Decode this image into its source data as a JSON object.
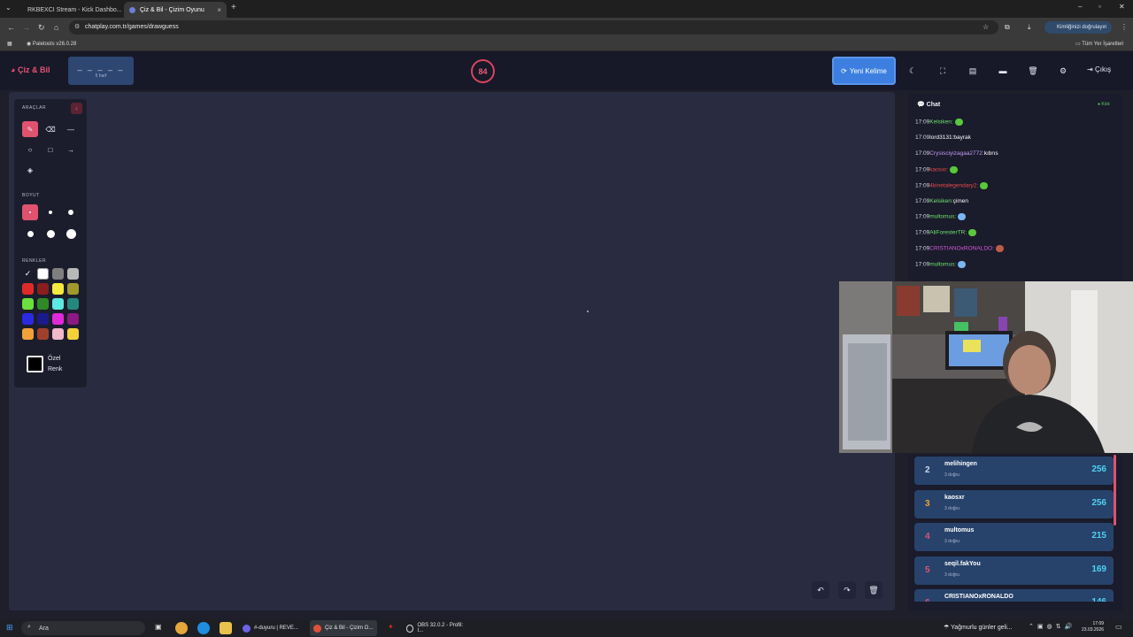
{
  "browser": {
    "tabs": [
      {
        "title": "RKBEXCI Stream - Kick Dashbo..."
      },
      {
        "title": "Çiz & Bil - Çizim Oyunu"
      }
    ],
    "url": "chatplay.com.tr/games/drawguess",
    "profile_label": "Kimliğinizi doğrulayın",
    "bookmarks": {
      "left": "Paletools v26.0.28",
      "right": "Tüm Yer İşaretleri"
    }
  },
  "app": {
    "logo": "Çiz & Bil",
    "word": {
      "mask": "_ _ _ _ _",
      "hint": "5 harf"
    },
    "timer": "84",
    "new_word_label": "Yeni Kelime",
    "logout_label": "Çıkış"
  },
  "tools": {
    "section_tools": "ARAÇLAR",
    "section_size": "BOYUT",
    "section_colors": "RENKLER",
    "custom_color_label": "Özel Renk",
    "selected_tool": "pen",
    "selected_size": 1,
    "selected_color": "#000000",
    "colors": [
      [
        "#000000",
        "#ffffff",
        "#7f7f7f",
        "#b8b8b8"
      ],
      [
        "#e02a2a",
        "#8c1d1d",
        "#f5ea3d",
        "#a19a2a"
      ],
      [
        "#6be03a",
        "#2f8a23",
        "#5ce8e3",
        "#24887f"
      ],
      [
        "#2a2ae0",
        "#1a1a8c",
        "#e02ad9",
        "#8c1a82"
      ],
      [
        "#f2a136",
        "#a0402a",
        "#f0b8c8",
        "#f5d03a"
      ]
    ]
  },
  "chat": {
    "title": "Chat",
    "source": "Kick",
    "messages": [
      {
        "time": "17:09",
        "user": "Kelsiken:",
        "text": "",
        "color": "#6ee26e",
        "emote": "#58c93a"
      },
      {
        "time": "17:09",
        "user": "lord3131:",
        "text": "bayrak",
        "color": "#ffffff",
        "emote": ""
      },
      {
        "time": "17:09",
        "user": "Crysisciyizagaa2772:",
        "text": "kıbrıs",
        "color": "#c39cf5",
        "emote": ""
      },
      {
        "time": "17:09",
        "user": "kaosxr:",
        "text": "",
        "color": "#e64a4a",
        "emote": "#58c93a"
      },
      {
        "time": "17:09",
        "user": "4kinetalegendary2:",
        "text": "",
        "color": "#e64a4a",
        "emote": "#58c93a"
      },
      {
        "time": "17:09",
        "user": "Kelsiken:",
        "text": "çimen",
        "color": "#6ee26e",
        "emote": ""
      },
      {
        "time": "17:09",
        "user": "multomus:",
        "text": "",
        "color": "#6ee26e",
        "emote": "#7ab6f0"
      },
      {
        "time": "17:09",
        "user": "AliForesterTR:",
        "text": "",
        "color": "#6ee26e",
        "emote": "#58c93a"
      },
      {
        "time": "17:09",
        "user": "CRISTIANOxRONALDO:",
        "text": "",
        "color": "#d35bd8",
        "emote": "#c05a48"
      },
      {
        "time": "17:09",
        "user": "multomus:",
        "text": "",
        "color": "#6ee26e",
        "emote": "#7ab6f0"
      }
    ]
  },
  "leaderboard": [
    {
      "rank": "2",
      "name": "melihingen",
      "sub": "3 doğru",
      "score": "256",
      "rank_color": "#cfd7ec"
    },
    {
      "rank": "3",
      "name": "kaosxr",
      "sub": "3 doğru",
      "score": "256",
      "rank_color": "#f2a136"
    },
    {
      "rank": "4",
      "name": "multomus",
      "sub": "3 doğru",
      "score": "215",
      "rank_color": "#e0526e"
    },
    {
      "rank": "5",
      "name": "seqil.fakYou",
      "sub": "3 doğru",
      "score": "169",
      "rank_color": "#e0526e"
    },
    {
      "rank": "6",
      "name": "CRISTIANOxRONALDO",
      "sub": "",
      "score": "146",
      "rank_color": "#e0526e"
    }
  ],
  "taskbar": {
    "search_placeholder": "Ara",
    "apps": [
      {
        "label": "#-duyuru | REVE..."
      },
      {
        "label": "Çiz & Bil - Çizim O..."
      },
      {
        "label": "OBS 32.0.2 - Profil: I..."
      }
    ],
    "weather": "Yağmurlu günler geli...",
    "time": "17:09",
    "date": "23.03.2026"
  }
}
